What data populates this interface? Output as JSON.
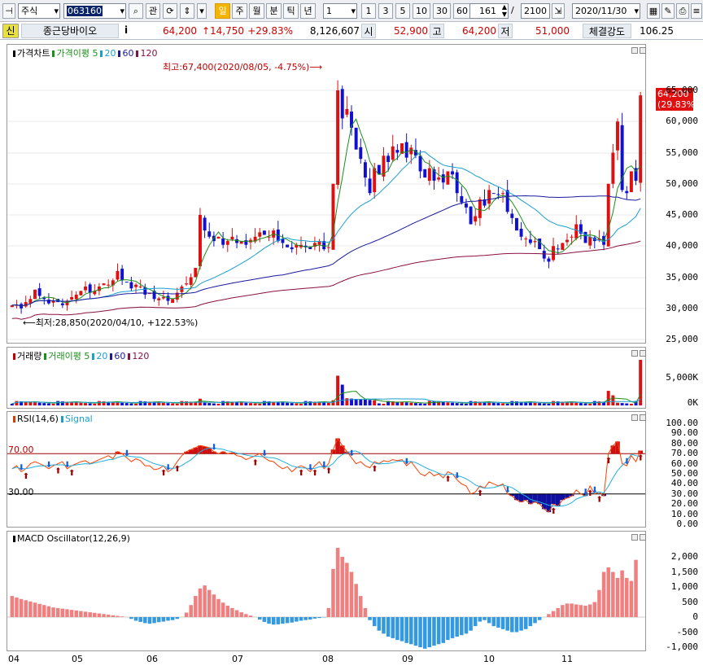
{
  "toolbar": {
    "market": "주식",
    "code": "063160",
    "buttons": [
      "관"
    ],
    "periods": [
      "일",
      "주",
      "월",
      "분",
      "틱",
      "년"
    ],
    "period_selected": "일",
    "unit_select": "1",
    "unit_buttons": [
      "1",
      "3",
      "5",
      "10",
      "30",
      "60"
    ],
    "count_value": "161",
    "total_value": "2100",
    "date_value": "2020/11/30"
  },
  "quote": {
    "badge": "신",
    "name": "종근당바이오",
    "info": "i",
    "price": "64,200",
    "change": "↑14,750",
    "change_pct": "+29.83%",
    "volume": "8,126,607",
    "open_label": "시",
    "open": "52,900",
    "high_label": "고",
    "high": "64,200",
    "low_label": "저",
    "low": "51,000",
    "strength_label": "체결강도",
    "strength": "106.25"
  },
  "price_panel": {
    "legend": [
      {
        "text": "가격차트",
        "color": "#000000"
      },
      {
        "text": "가격이평 5",
        "color": "#1b8f1b"
      },
      {
        "text": "20",
        "color": "#1aa0d0"
      },
      {
        "text": "60",
        "color": "#1a1aa0"
      },
      {
        "text": "120",
        "color": "#8a1040"
      }
    ],
    "high_note": "최고:67,400(2020/08/05, -4.75%)",
    "low_note": "최저:28,850(2020/04/10, +122.53%)",
    "current_box": [
      "64,200",
      "(29.83%)"
    ],
    "ticks": [
      "65,000",
      "60,000",
      "55,000",
      "50,000",
      "45,000",
      "40,000",
      "35,000",
      "30,000",
      "25,000"
    ]
  },
  "volume_panel": {
    "legend": [
      {
        "text": "거래량",
        "color": "#c00000"
      },
      {
        "text": "거래이평 5",
        "color": "#1b8f1b"
      },
      {
        "text": "20",
        "color": "#1aa0d0"
      },
      {
        "text": "60",
        "color": "#1a1aa0"
      },
      {
        "text": "120",
        "color": "#8a1040"
      }
    ],
    "ticks": [
      "5,000K",
      "0K"
    ]
  },
  "rsi_panel": {
    "legend": [
      {
        "text": "RSI(14,6)",
        "color": "#d04000"
      },
      {
        "text": "Signal",
        "color": "#1aa0d0"
      }
    ],
    "level_high": "70.00",
    "level_low": "30.00",
    "ticks": [
      "100.00",
      "90.00",
      "80.00",
      "70.00",
      "60.00",
      "50.00",
      "40.00",
      "30.00",
      "20.00",
      "10.00",
      "0.00"
    ]
  },
  "macd_panel": {
    "legend": [
      {
        "text": "MACD Oscillator(12,26,9)",
        "color": "#000000"
      }
    ],
    "ticks": [
      "2,000",
      "1,500",
      "1,000",
      "500",
      "0",
      "-500",
      "-1,000"
    ]
  },
  "x_labels": [
    "04",
    "05",
    "06",
    "07",
    "08",
    "09",
    "10",
    "11"
  ],
  "colors": {
    "up": "#e01010",
    "down": "#1010d0",
    "ma5": "#1b8f1b",
    "ma20": "#1aa0d0",
    "ma60": "#1a1aa0",
    "ma120": "#8a1040",
    "rsi": "#ff4000",
    "signal": "#20b0e0",
    "macd_pos": "#f08080",
    "macd_neg": "#3399e0"
  },
  "chart_data": {
    "type": "candlestick",
    "x": [
      "04",
      "05",
      "06",
      "07",
      "08",
      "09",
      "10",
      "11"
    ],
    "close": [
      30500,
      30600,
      30000,
      31000,
      31500,
      33000,
      32000,
      31500,
      30800,
      31200,
      31000,
      30500,
      31200,
      31800,
      32200,
      32800,
      33500,
      32500,
      32800,
      33500,
      34000,
      33800,
      34500,
      36000,
      34500,
      34200,
      33200,
      33800,
      33500,
      32200,
      32500,
      31500,
      31600,
      31800,
      31200,
      31500,
      32500,
      33500,
      34000,
      35000,
      36500,
      45000,
      42500,
      41500,
      40800,
      41500,
      40200,
      40800,
      41500,
      40500,
      40800,
      40200,
      41000,
      41500,
      42200,
      41800,
      41500,
      42500,
      40800,
      40500,
      39800,
      39500,
      40200,
      40200,
      39800,
      39500,
      40500,
      40800,
      39500,
      39800,
      50000,
      65000,
      60500,
      62000,
      59000,
      55500,
      54000,
      51000,
      48500,
      52500,
      51500,
      54500,
      53500,
      56000,
      55000,
      56500,
      54200,
      55800,
      54500,
      52000,
      51000,
      52500,
      50500,
      51000,
      50200,
      52000,
      51500,
      48500,
      47000,
      46200,
      43500,
      44800,
      47500,
      46500,
      49000,
      48500,
      48200,
      48500,
      45500,
      44500,
      42500,
      41500,
      41200,
      40500,
      40800,
      39500,
      38000,
      37500,
      40000,
      39500,
      40500,
      41000,
      41500,
      43500,
      42000,
      40500,
      41500,
      40800,
      41200,
      40200,
      50000,
      55000,
      60000,
      49000,
      48500,
      52000,
      50500,
      64200
    ],
    "ylim": [
      25000,
      67400
    ],
    "price_high": 67400,
    "price_low": 28850,
    "current": 64200,
    "rsi": [
      55,
      58,
      52,
      55,
      60,
      62,
      60,
      58,
      55,
      58,
      60,
      62,
      55,
      58,
      60,
      62,
      63,
      60,
      62,
      64,
      66,
      68,
      65,
      72,
      70,
      66,
      62,
      65,
      63,
      58,
      58,
      54,
      55,
      58,
      52,
      55,
      62,
      68,
      72,
      74,
      76,
      78,
      77,
      76,
      72,
      70,
      72,
      70,
      71,
      68,
      67,
      64,
      66,
      68,
      70,
      66,
      63,
      62,
      58,
      55,
      57,
      52,
      56,
      58,
      56,
      52,
      58,
      62,
      55,
      60,
      74,
      85,
      78,
      72,
      66,
      60,
      62,
      58,
      56,
      62,
      60,
      63,
      62,
      64,
      63,
      64,
      58,
      62,
      56,
      50,
      48,
      52,
      48,
      50,
      46,
      52,
      50,
      44,
      40,
      38,
      30,
      32,
      38,
      36,
      42,
      40,
      38,
      40,
      30,
      28,
      24,
      22,
      24,
      20,
      22,
      20,
      15,
      12,
      20,
      18,
      24,
      26,
      28,
      34,
      30,
      28,
      38,
      30,
      32,
      28,
      70,
      78,
      82,
      60,
      58,
      68,
      62,
      73
    ],
    "macd": [
      700,
      650,
      600,
      560,
      520,
      480,
      440,
      400,
      360,
      320,
      300,
      280,
      260,
      240,
      220,
      200,
      180,
      160,
      140,
      120,
      100,
      80,
      60,
      40,
      20,
      0,
      -60,
      -120,
      -160,
      -200,
      -220,
      -200,
      -170,
      -150,
      -120,
      -100,
      -60,
      0,
      150,
      400,
      700,
      950,
      1050,
      900,
      750,
      600,
      480,
      380,
      300,
      230,
      160,
      100,
      50,
      0,
      -80,
      -160,
      -220,
      -250,
      -240,
      -220,
      -200,
      -180,
      -150,
      -120,
      -100,
      -80,
      -50,
      -30,
      -10,
      300,
      1600,
      2300,
      2000,
      1800,
      1500,
      1100,
      700,
      300,
      -100,
      -300,
      -450,
      -550,
      -650,
      -700,
      -760,
      -800,
      -860,
      -900,
      -950,
      -1000,
      -1050,
      -1000,
      -950,
      -900,
      -860,
      -760,
      -700,
      -650,
      -600,
      -550,
      -450,
      -300,
      -150,
      -100,
      -200,
      -300,
      -350,
      -400,
      -450,
      -500,
      -500,
      -450,
      -400,
      -300,
      -200,
      -100,
      0,
      100,
      200,
      300,
      400,
      450,
      450,
      420,
      400,
      380,
      420,
      500,
      900,
      1500,
      1650,
      1500,
      1300,
      1550,
      1300,
      1200,
      1900
    ]
  }
}
